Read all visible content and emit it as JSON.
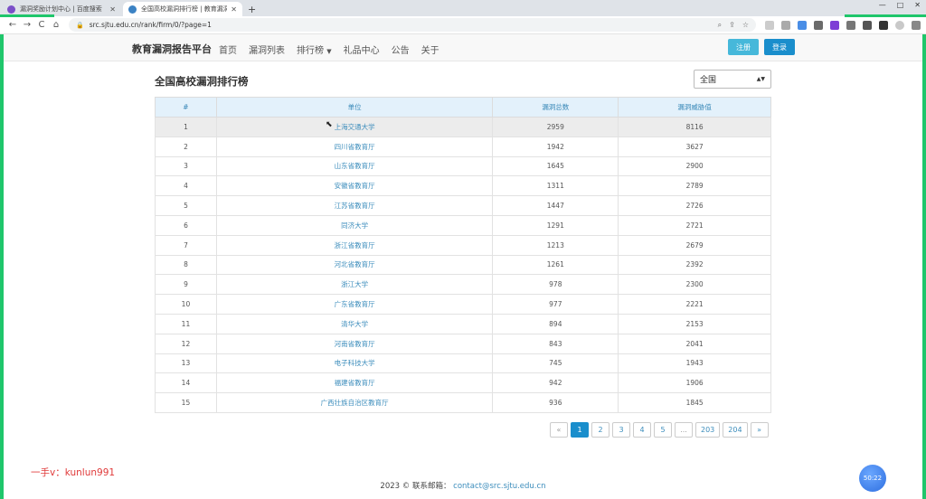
{
  "browser": {
    "tabs": [
      {
        "title": "漏洞奖励计划中心 | 百度搜索",
        "active": false
      },
      {
        "title": "全国高校漏洞排行榜 | 教育漏洞报",
        "active": true
      }
    ],
    "url": "src.sjtu.edu.cn/rank/firm/0/?page=1",
    "back": "←",
    "forward": "→",
    "reload": "C",
    "home": "⌂",
    "lock": "🔒",
    "newtab": "+",
    "win_min": "—",
    "win_max": "□",
    "win_close": "✕"
  },
  "nav": {
    "brand": "教育漏洞报告平台",
    "links": [
      "首页",
      "漏洞列表",
      "排行榜",
      "礼品中心",
      "公告",
      "关于"
    ],
    "register": "注册",
    "login": "登录"
  },
  "page": {
    "title": "全国高校漏洞排行榜",
    "region": "全国"
  },
  "table": {
    "headers": [
      "#",
      "单位",
      "漏洞总数",
      "漏洞威胁值"
    ],
    "rows": [
      [
        "1",
        "上海交通大学",
        "2959",
        "8116"
      ],
      [
        "2",
        "四川省教育厅",
        "1942",
        "3627"
      ],
      [
        "3",
        "山东省教育厅",
        "1645",
        "2900"
      ],
      [
        "4",
        "安徽省教育厅",
        "1311",
        "2789"
      ],
      [
        "5",
        "江苏省教育厅",
        "1447",
        "2726"
      ],
      [
        "6",
        "同济大学",
        "1291",
        "2721"
      ],
      [
        "7",
        "浙江省教育厅",
        "1213",
        "2679"
      ],
      [
        "8",
        "河北省教育厅",
        "1261",
        "2392"
      ],
      [
        "9",
        "浙江大学",
        "978",
        "2300"
      ],
      [
        "10",
        "广东省教育厅",
        "977",
        "2221"
      ],
      [
        "11",
        "清华大学",
        "894",
        "2153"
      ],
      [
        "12",
        "河南省教育厅",
        "843",
        "2041"
      ],
      [
        "13",
        "电子科技大学",
        "745",
        "1943"
      ],
      [
        "14",
        "福建省教育厅",
        "942",
        "1906"
      ],
      [
        "15",
        "广西壮族自治区教育厅",
        "936",
        "1845"
      ]
    ]
  },
  "pagination": {
    "prev": "«",
    "pages": [
      "1",
      "2",
      "3",
      "4",
      "5",
      "...",
      "203",
      "204"
    ],
    "next": "»",
    "current": "1"
  },
  "footer": {
    "text": "2023 © 联系邮箱：",
    "email": "contact@src.sjtu.edu.cn"
  },
  "overlay": {
    "watermark": "一手v：kunlun991",
    "timer": "50:22"
  },
  "colors": {
    "accent": "#1a8ecc",
    "register": "#46b8da",
    "header_bg": "#e3f1fb",
    "border_green": "#1fc66b"
  }
}
